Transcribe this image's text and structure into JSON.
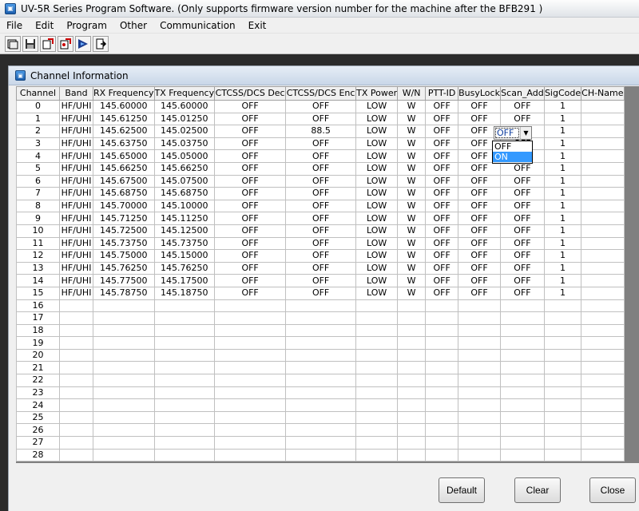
{
  "window": {
    "title": "UV-5R Series Program Software. (Only supports firmware version number for the machine after the BFB291 )"
  },
  "menu": [
    "File",
    "Edit",
    "Program",
    "Other",
    "Communication",
    "Exit"
  ],
  "toolbar": [
    "open-icon",
    "save-icon",
    "read-radio-icon",
    "write-radio-icon",
    "monitor-icon",
    "exit-icon"
  ],
  "child_window": {
    "title": "Channel Information"
  },
  "columns": [
    "Channel",
    "Band",
    "RX Frequency",
    "TX Frequency",
    "CTCSS/DCS Dec",
    "CTCSS/DCS Enc",
    "TX Power",
    "W/N",
    "PTT-ID",
    "BusyLock",
    "Scan_Add",
    "SigCode",
    "CH-Name"
  ],
  "rows": [
    [
      "0",
      "HF/UHI",
      "145.60000",
      "145.60000",
      "OFF",
      "OFF",
      "LOW",
      "W",
      "OFF",
      "OFF",
      "OFF",
      "1",
      ""
    ],
    [
      "1",
      "HF/UHI",
      "145.61250",
      "145.01250",
      "OFF",
      "OFF",
      "LOW",
      "W",
      "OFF",
      "OFF",
      "OFF",
      "1",
      ""
    ],
    [
      "2",
      "HF/UHI",
      "145.62500",
      "145.02500",
      "OFF",
      "88.5",
      "LOW",
      "W",
      "OFF",
      "OFF",
      "OFF",
      "1",
      ""
    ],
    [
      "3",
      "HF/UHI",
      "145.63750",
      "145.03750",
      "OFF",
      "OFF",
      "LOW",
      "W",
      "OFF",
      "OFF",
      "OFF",
      "1",
      ""
    ],
    [
      "4",
      "HF/UHI",
      "145.65000",
      "145.05000",
      "OFF",
      "OFF",
      "LOW",
      "W",
      "OFF",
      "OFF",
      "ON",
      "1",
      ""
    ],
    [
      "5",
      "HF/UHI",
      "145.66250",
      "145.66250",
      "OFF",
      "OFF",
      "LOW",
      "W",
      "OFF",
      "OFF",
      "OFF",
      "1",
      ""
    ],
    [
      "6",
      "HF/UHI",
      "145.67500",
      "145.07500",
      "OFF",
      "OFF",
      "LOW",
      "W",
      "OFF",
      "OFF",
      "OFF",
      "1",
      ""
    ],
    [
      "7",
      "HF/UHI",
      "145.68750",
      "145.68750",
      "OFF",
      "OFF",
      "LOW",
      "W",
      "OFF",
      "OFF",
      "OFF",
      "1",
      ""
    ],
    [
      "8",
      "HF/UHI",
      "145.70000",
      "145.10000",
      "OFF",
      "OFF",
      "LOW",
      "W",
      "OFF",
      "OFF",
      "OFF",
      "1",
      ""
    ],
    [
      "9",
      "HF/UHI",
      "145.71250",
      "145.11250",
      "OFF",
      "OFF",
      "LOW",
      "W",
      "OFF",
      "OFF",
      "OFF",
      "1",
      ""
    ],
    [
      "10",
      "HF/UHI",
      "145.72500",
      "145.12500",
      "OFF",
      "OFF",
      "LOW",
      "W",
      "OFF",
      "OFF",
      "OFF",
      "1",
      ""
    ],
    [
      "11",
      "HF/UHI",
      "145.73750",
      "145.73750",
      "OFF",
      "OFF",
      "LOW",
      "W",
      "OFF",
      "OFF",
      "OFF",
      "1",
      ""
    ],
    [
      "12",
      "HF/UHI",
      "145.75000",
      "145.15000",
      "OFF",
      "OFF",
      "LOW",
      "W",
      "OFF",
      "OFF",
      "OFF",
      "1",
      ""
    ],
    [
      "13",
      "HF/UHI",
      "145.76250",
      "145.76250",
      "OFF",
      "OFF",
      "LOW",
      "W",
      "OFF",
      "OFF",
      "OFF",
      "1",
      ""
    ],
    [
      "14",
      "HF/UHI",
      "145.77500",
      "145.17500",
      "OFF",
      "OFF",
      "LOW",
      "W",
      "OFF",
      "OFF",
      "OFF",
      "1",
      ""
    ],
    [
      "15",
      "HF/UHI",
      "145.78750",
      "145.18750",
      "OFF",
      "OFF",
      "LOW",
      "W",
      "OFF",
      "OFF",
      "OFF",
      "1",
      ""
    ],
    [
      "16",
      "",
      "",
      "",
      "",
      "",
      "",
      "",
      "",
      "",
      "",
      "",
      ""
    ],
    [
      "17",
      "",
      "",
      "",
      "",
      "",
      "",
      "",
      "",
      "",
      "",
      "",
      ""
    ],
    [
      "18",
      "",
      "",
      "",
      "",
      "",
      "",
      "",
      "",
      "",
      "",
      "",
      ""
    ],
    [
      "19",
      "",
      "",
      "",
      "",
      "",
      "",
      "",
      "",
      "",
      "",
      "",
      ""
    ],
    [
      "20",
      "",
      "",
      "",
      "",
      "",
      "",
      "",
      "",
      "",
      "",
      "",
      ""
    ],
    [
      "21",
      "",
      "",
      "",
      "",
      "",
      "",
      "",
      "",
      "",
      "",
      "",
      ""
    ],
    [
      "22",
      "",
      "",
      "",
      "",
      "",
      "",
      "",
      "",
      "",
      "",
      "",
      ""
    ],
    [
      "23",
      "",
      "",
      "",
      "",
      "",
      "",
      "",
      "",
      "",
      "",
      "",
      ""
    ],
    [
      "24",
      "",
      "",
      "",
      "",
      "",
      "",
      "",
      "",
      "",
      "",
      "",
      ""
    ],
    [
      "25",
      "",
      "",
      "",
      "",
      "",
      "",
      "",
      "",
      "",
      "",
      "",
      ""
    ],
    [
      "26",
      "",
      "",
      "",
      "",
      "",
      "",
      "",
      "",
      "",
      "",
      "",
      ""
    ],
    [
      "27",
      "",
      "",
      "",
      "",
      "",
      "",
      "",
      "",
      "",
      "",
      "",
      ""
    ],
    [
      "28",
      "",
      "",
      "",
      "",
      "",
      "",
      "",
      "",
      "",
      "",
      "",
      ""
    ]
  ],
  "combo": {
    "value": "OFF",
    "options": [
      "OFF",
      "ON"
    ],
    "selected": "ON"
  },
  "buttons": {
    "default": "Default",
    "clear": "Clear",
    "close": "Close"
  }
}
